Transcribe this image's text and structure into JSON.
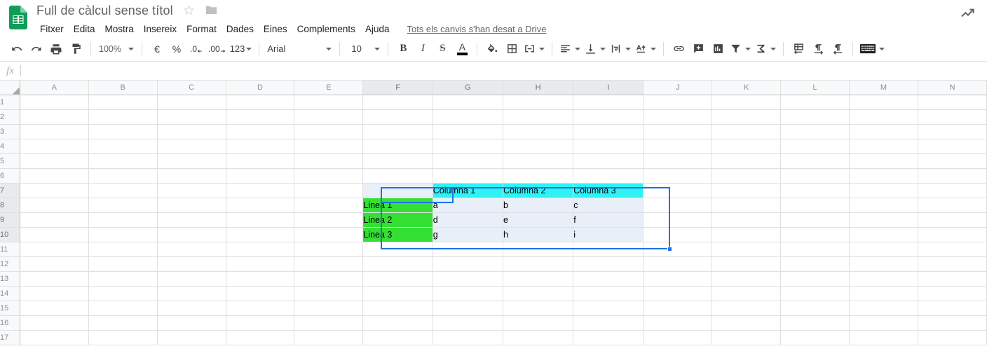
{
  "app": {
    "logo_icon": "sheets-logo-icon",
    "doc_title": "Full de càlcul sense títol",
    "star_icon": "star-outline-icon",
    "folder_icon": "folder-icon",
    "trend_icon": "trending-up-icon"
  },
  "menu": {
    "items": [
      {
        "label": "Fitxer",
        "name": "menu-item-fitxer"
      },
      {
        "label": "Edita",
        "name": "menu-item-edita"
      },
      {
        "label": "Mostra",
        "name": "menu-item-mostra"
      },
      {
        "label": "Insereix",
        "name": "menu-item-insereix"
      },
      {
        "label": "Format",
        "name": "menu-item-format"
      },
      {
        "label": "Dades",
        "name": "menu-item-dades"
      },
      {
        "label": "Eines",
        "name": "menu-item-eines"
      },
      {
        "label": "Complements",
        "name": "menu-item-complements"
      },
      {
        "label": "Ajuda",
        "name": "menu-item-ajuda"
      }
    ],
    "save_status": "Tots els canvis s'han desat a Drive"
  },
  "toolbar": {
    "undo_icon": "undo-icon",
    "redo_icon": "redo-icon",
    "print_icon": "print-icon",
    "paint_format_icon": "paint-format-icon",
    "zoom_value": "100%",
    "currency_label": "€",
    "percent_label": "%",
    "decrease_decimal_label": ".0",
    "increase_decimal_label": ".00",
    "number_format_label": "123",
    "font_family_value": "Arial",
    "font_size_value": "10",
    "bold_label": "B",
    "italic_label": "I",
    "strikethrough_label": "S",
    "text_color_label": "A",
    "text_color_swatch": "#000000",
    "fill_color_icon": "fill-color-icon",
    "borders_icon": "borders-icon",
    "merge_cells_icon": "merge-cells-icon",
    "horizontal_align_icon": "horizontal-align-icon",
    "vertical_align_icon": "vertical-align-icon",
    "text_wrap_icon": "text-wrap-icon",
    "text_rotation_icon": "text-rotation-icon",
    "insert_link_icon": "insert-link-icon",
    "insert_comment_icon": "insert-comment-icon",
    "insert_chart_icon": "insert-chart-icon",
    "filter_icon": "filter-icon",
    "functions_icon": "functions-sigma-icon",
    "rtl_ltr_icon": "text-direction-icon",
    "paragraph_ltr_icon": "paragraph-ltr-icon",
    "paragraph_rtl_icon": "paragraph-rtl-icon",
    "input_tools_icon": "keyboard-input-tools-icon"
  },
  "formula_bar": {
    "fx_label": "fx",
    "name_box_value": "",
    "formula_value": "",
    "placeholder": ""
  },
  "grid": {
    "column_headers": [
      "A",
      "B",
      "C",
      "D",
      "E",
      "F",
      "G",
      "H",
      "I",
      "J",
      "K",
      "L",
      "M",
      "N"
    ],
    "row_headers": [
      "1",
      "2",
      "3",
      "4",
      "5",
      "6",
      "7",
      "8",
      "9",
      "10",
      "11",
      "12",
      "13",
      "14",
      "15",
      "16",
      "17"
    ],
    "selected_columns": [
      "F",
      "G",
      "H",
      "I"
    ],
    "selected_rows": [
      "7",
      "8",
      "9",
      "10"
    ],
    "active_cell": "F7",
    "selection_range": "F7:I10",
    "colors": {
      "header_fill": "#2ff2f5",
      "row_label_fill": "#35e035",
      "selection_tint": "#e8eff9",
      "selection_border": "#1a73e8"
    },
    "table": {
      "corner_cell": "",
      "column_labels": [
        "Columna 1",
        "Columna 2",
        "Columna 3"
      ],
      "row_labels": [
        "Linea 1",
        "Linea 2",
        "Linea 3"
      ],
      "values": [
        [
          "a",
          "b",
          "c"
        ],
        [
          "d",
          "e",
          "f"
        ],
        [
          "g",
          "h",
          "i"
        ]
      ]
    }
  }
}
